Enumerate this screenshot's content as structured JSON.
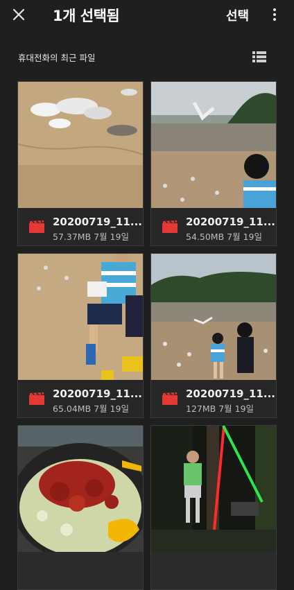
{
  "header": {
    "title": "1개 선택됨",
    "select_label": "선택"
  },
  "section": {
    "label": "휴대전화의 최근 파일"
  },
  "files": [
    {
      "name": "20200719_11...",
      "info": "57.37MB 7월 19일"
    },
    {
      "name": "20200719_11...",
      "info": "54.50MB 7월 19일"
    },
    {
      "name": "20200719_11...",
      "info": "65.04MB 7월 19일"
    },
    {
      "name": "20200719_11...",
      "info": "127MB 7월 19일"
    }
  ],
  "colors": {
    "background": "#1f1f1f",
    "card": "#2b2b2b",
    "video_icon": "#e53935"
  },
  "icons": {
    "close": "close-icon",
    "more": "more-vert-icon",
    "view": "list-view-icon",
    "video": "video-file-icon"
  }
}
